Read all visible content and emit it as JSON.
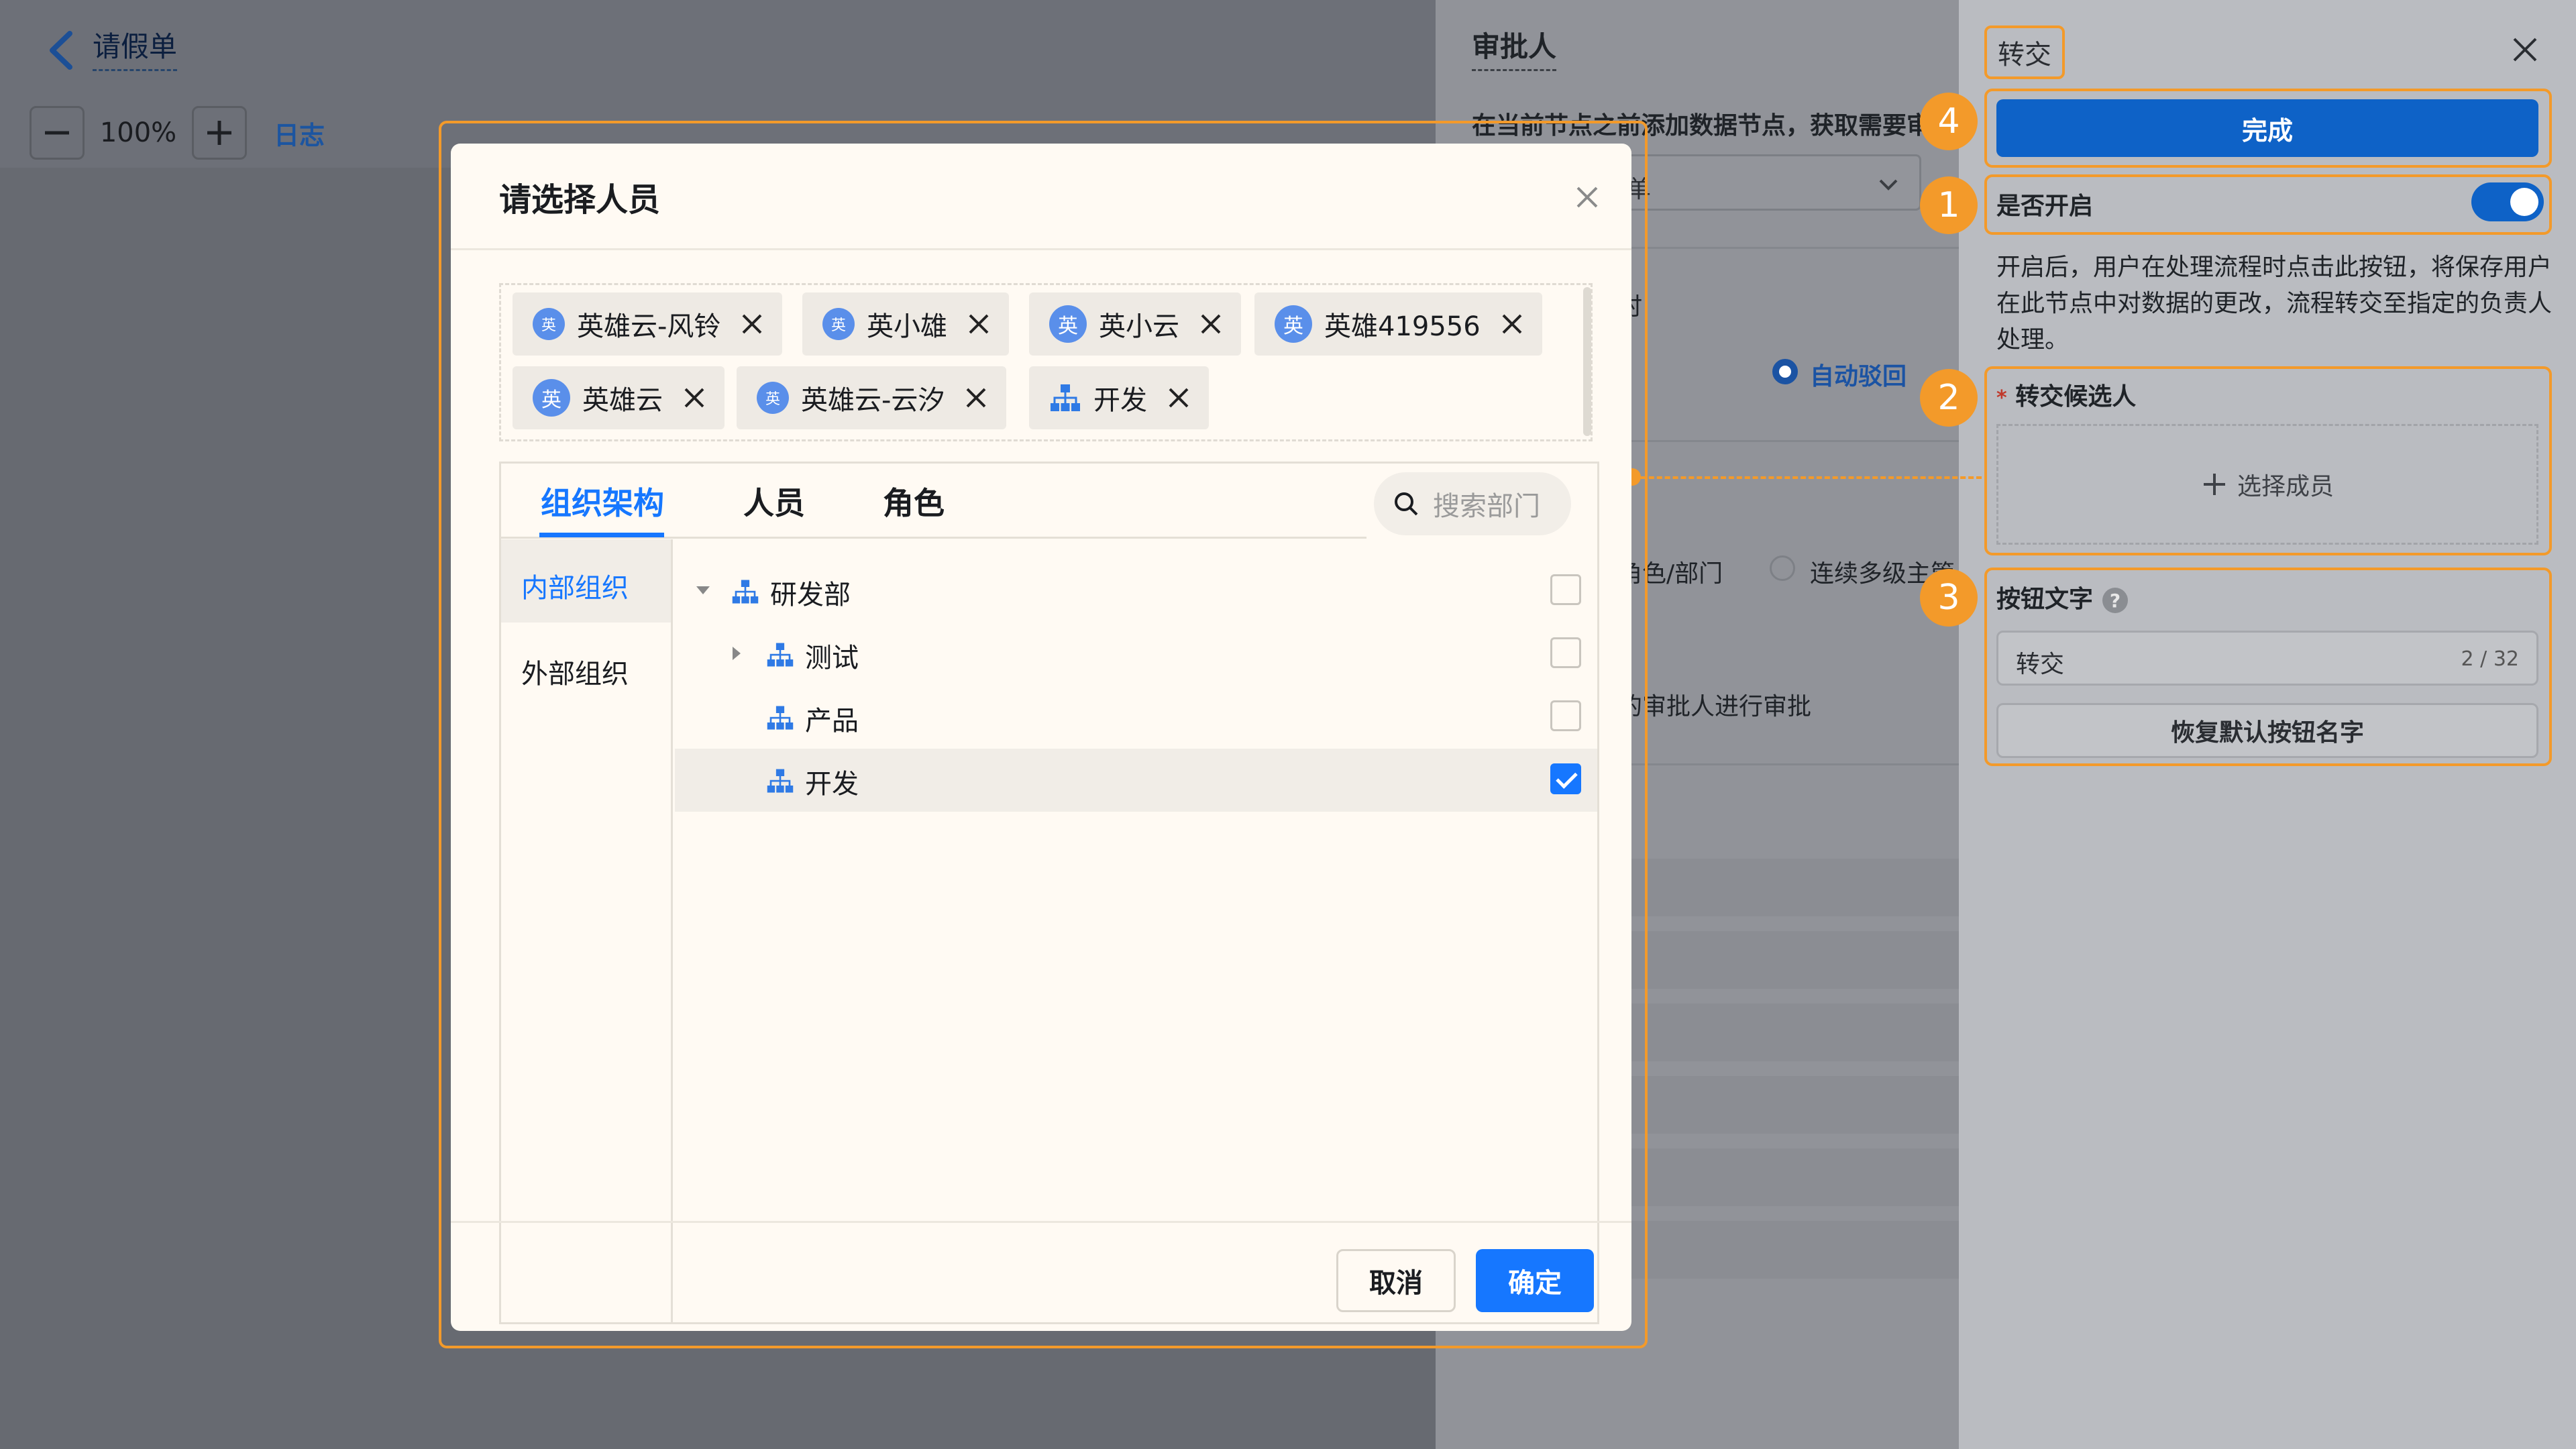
{
  "header": {
    "title": "请假单",
    "zoom": "100%",
    "log_label": "日志"
  },
  "config_panel": {
    "title": "审批人",
    "description": "在当前节点之前添加数据节点，获取需要审",
    "select_value": "单",
    "text_time": "时",
    "radio_auto_reject": "自动驳回",
    "text_role_dept": "角色/部门",
    "radio_multi_level": "连续多级主管",
    "text_approve": "的审批人进行审批"
  },
  "transfer_panel": {
    "title": "转交",
    "done_label": "完成",
    "enable_label": "是否开启",
    "enabled": true,
    "help_text": "开启后，用户在处理流程时点击此按钮，将保存用户在此节点中对数据的更改，流程转交至指定的负责人处理。",
    "candidates_label": "转交候选人",
    "required_mark": "*",
    "select_member_label": "选择成员",
    "button_text_label": "按钮文字",
    "help_badge": "?",
    "button_text_value": "转交",
    "button_text_count": "2 / 32",
    "reset_label": "恢复默认按钮名字"
  },
  "steps": [
    "1",
    "2",
    "3",
    "4"
  ],
  "modal": {
    "title": "请选择人员",
    "chips": [
      {
        "avatar": "英",
        "label": "英雄云-风铃",
        "type": "user"
      },
      {
        "avatar": "英",
        "label": "英小雄",
        "type": "user"
      },
      {
        "avatar": "英",
        "label": "英小云",
        "type": "user"
      },
      {
        "avatar": "英",
        "label": "英雄419556",
        "type": "user"
      },
      {
        "avatar": "英",
        "label": "英雄云",
        "type": "user"
      },
      {
        "avatar": "英",
        "label": "英雄云-云汐",
        "type": "user"
      },
      {
        "avatar": "",
        "label": "开发",
        "type": "dept"
      }
    ],
    "tabs": [
      "组织架构",
      "人员",
      "角色"
    ],
    "search_placeholder": "搜索部门",
    "side_nav": [
      "内部组织",
      "外部组织"
    ],
    "tree": [
      {
        "label": "研发部",
        "checked": false
      },
      {
        "label": "测试",
        "checked": false
      },
      {
        "label": "产品",
        "checked": false
      },
      {
        "label": "开发",
        "checked": true
      }
    ],
    "cancel_label": "取消",
    "ok_label": "确定"
  },
  "colors": {
    "primary": "#1677ff",
    "highlight": "#f39a2a",
    "done_button": "#0e62c7"
  }
}
